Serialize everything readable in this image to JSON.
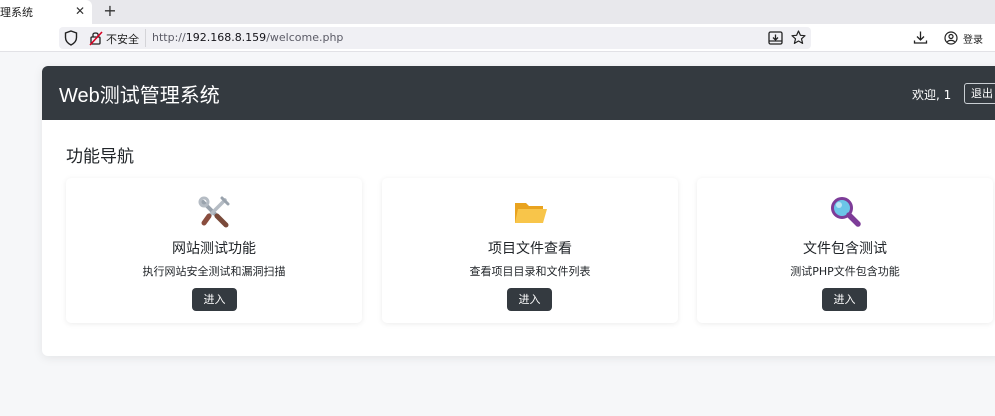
{
  "browser": {
    "tab_title": "理系统",
    "tab_close": "✕",
    "new_tab": "+",
    "insecure_label": "不安全",
    "url_prefix": "http://",
    "url_host": "192.168.8.159",
    "url_path": "/welcome.php",
    "login_label": "登录"
  },
  "header": {
    "site_title": "Web测试管理系统",
    "welcome_text": "欢迎, 1",
    "logout_label": "退出"
  },
  "nav": {
    "section_title": "功能导航",
    "features": [
      {
        "icon": "tools-icon",
        "name": "网站测试功能",
        "description": "执行网站安全测试和漏洞扫描",
        "button": "进入"
      },
      {
        "icon": "folder-icon",
        "name": "项目文件查看",
        "description": "查看项目目录和文件列表",
        "button": "进入"
      },
      {
        "icon": "magnifier-icon",
        "name": "文件包含测试",
        "description": "测试PHP文件包含功能",
        "button": "进入"
      }
    ]
  },
  "colors": {
    "header_bg": "#343a40",
    "button_bg": "#343a40",
    "page_bg": "#f6f7f9",
    "folder": "#f5b82e",
    "magnifier": "#7d3c98"
  }
}
